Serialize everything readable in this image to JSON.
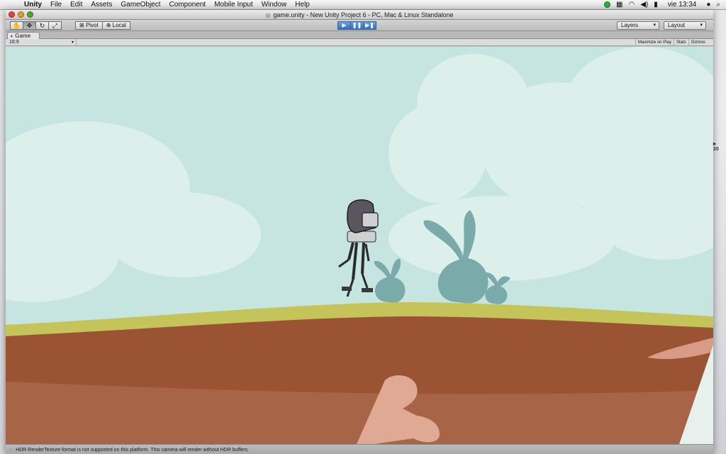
{
  "menubar": {
    "apple": "",
    "items": [
      "Unity",
      "File",
      "Edit",
      "Assets",
      "GameObject",
      "Component",
      "Mobile Input",
      "Window",
      "Help"
    ],
    "clock": "vie 13:34"
  },
  "window": {
    "title": "game.unity - New Unity Project 6 - PC, Mac & Linux Standalone"
  },
  "toolbar": {
    "pivot_label": "Pivot",
    "local_label": "Local",
    "layers_label": "Layers",
    "layout_label": "Layout"
  },
  "tab": {
    "label": "Game"
  },
  "gamebar": {
    "aspect": "16:9",
    "maximize": "Maximize on Play",
    "stats": "Stats",
    "gizmos": "Gizmos"
  },
  "status": {
    "message": "HDR RenderTexture format is not supported on this platform. This camera will render without HDR buffers."
  },
  "side": {
    "label": "20"
  },
  "colors": {
    "sky": "#c6e4e0",
    "cloud": "#e4f1ee",
    "grass": "#c5c45a",
    "dirt": "#9a5434",
    "bone": "#e0a994",
    "plant": "#7aabaa",
    "robot_head": "#5b5461"
  }
}
